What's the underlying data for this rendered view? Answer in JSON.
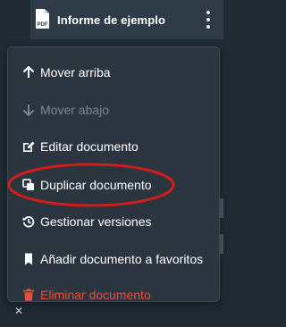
{
  "document": {
    "title": "Informe de ejemplo",
    "icon": "pdf-file-icon",
    "icon_text": "PDF"
  },
  "menu": {
    "items": [
      {
        "label": "Mover arriba",
        "icon": "arrow-up-icon",
        "state": "enabled"
      },
      {
        "label": "Mover abajo",
        "icon": "arrow-down-icon",
        "state": "disabled"
      },
      {
        "label": "Editar documento",
        "icon": "edit-icon",
        "state": "enabled"
      },
      {
        "label": "Duplicar documento",
        "icon": "duplicate-icon",
        "state": "enabled",
        "highlighted": true
      },
      {
        "label": "Gestionar versiones",
        "icon": "history-icon",
        "state": "enabled"
      },
      {
        "label": "Añadir documento a favoritos",
        "icon": "bookmark-icon",
        "state": "enabled"
      },
      {
        "label": "Eliminar documento",
        "icon": "trash-icon",
        "state": "danger"
      }
    ]
  },
  "colors": {
    "danger": "#e74c3c",
    "highlight_ring": "#d01c1c",
    "menu_bg": "#2a3540"
  }
}
